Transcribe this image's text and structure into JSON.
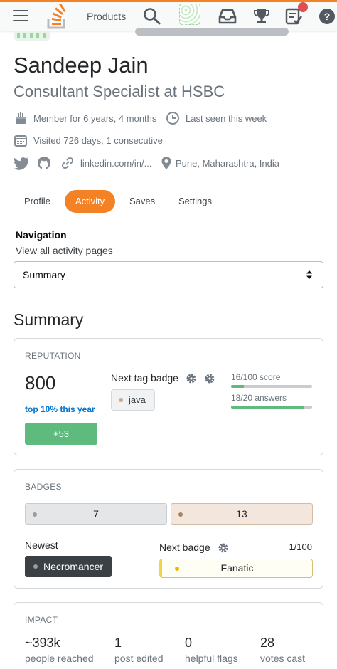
{
  "topbar": {
    "products_label": "Products",
    "accent": "#f48225",
    "icons": [
      "hamburger-icon",
      "stackoverflow-logo",
      "search-icon",
      "avatar",
      "inbox-icon",
      "trophy-icon",
      "review-queue-icon",
      "help-icon"
    ]
  },
  "profile": {
    "name": "Sandeep Jain",
    "title": "Consultant Specialist at HSBC",
    "member_for": "Member for 6 years, 4 months",
    "last_seen": "Last seen this week",
    "visited": "Visited 726 days, 1 consecutive",
    "linkedin": "linkedin.com/in/...",
    "location": "Pune, Maharashtra, India"
  },
  "tabs": [
    {
      "label": "Profile",
      "active": false
    },
    {
      "label": "Activity",
      "active": true
    },
    {
      "label": "Saves",
      "active": false
    },
    {
      "label": "Settings",
      "active": false
    }
  ],
  "navigation": {
    "heading": "Navigation",
    "subheading": "View all activity pages",
    "selected": "Summary"
  },
  "summary": {
    "heading": "Summary",
    "reputation": {
      "label": "REPUTATION",
      "value": "800",
      "rank": "top 10% this year",
      "change": "+53",
      "next_tag_badge_label": "Next tag badge",
      "tag": "java",
      "score_label": "16/100 score",
      "score_fraction": 0.16,
      "answers_label": "18/20 answers",
      "answers_fraction": 0.9
    },
    "badges": {
      "label": "BADGES",
      "silver": "7",
      "bronze": "13",
      "newest_label": "Newest",
      "newest_badge": "Necromancer",
      "next_badge_label": "Next badge",
      "next_badge_progress": "1/100",
      "next_badge": "Fanatic",
      "colors": {
        "silver": "#9a9c9f",
        "bronze": "#ab825f",
        "gold": "#e9b900"
      }
    },
    "impact": {
      "label": "IMPACT",
      "stats": [
        {
          "value": "~393k",
          "label": "people reached"
        },
        {
          "value": "1",
          "label": "post edited"
        },
        {
          "value": "0",
          "label": "helpful flags"
        },
        {
          "value": "28",
          "label": "votes cast"
        }
      ]
    }
  }
}
